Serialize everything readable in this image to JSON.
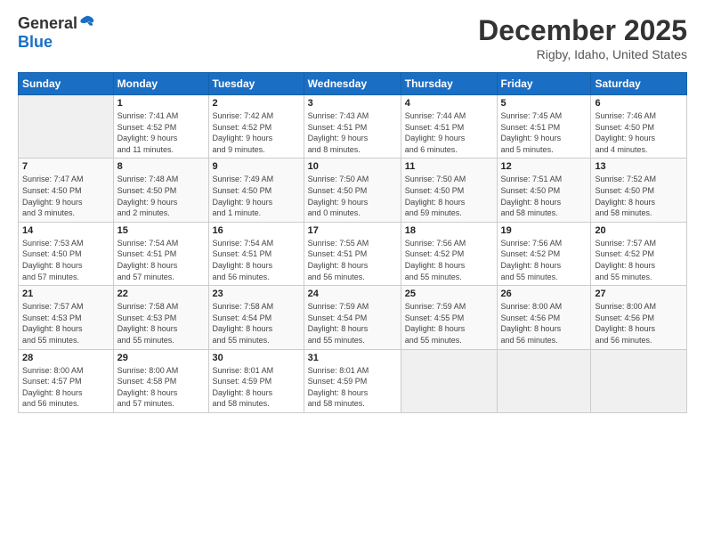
{
  "logo": {
    "general": "General",
    "blue": "Blue"
  },
  "title": "December 2025",
  "location": "Rigby, Idaho, United States",
  "days_header": [
    "Sunday",
    "Monday",
    "Tuesday",
    "Wednesday",
    "Thursday",
    "Friday",
    "Saturday"
  ],
  "weeks": [
    [
      {
        "num": "",
        "info": ""
      },
      {
        "num": "1",
        "info": "Sunrise: 7:41 AM\nSunset: 4:52 PM\nDaylight: 9 hours\nand 11 minutes."
      },
      {
        "num": "2",
        "info": "Sunrise: 7:42 AM\nSunset: 4:52 PM\nDaylight: 9 hours\nand 9 minutes."
      },
      {
        "num": "3",
        "info": "Sunrise: 7:43 AM\nSunset: 4:51 PM\nDaylight: 9 hours\nand 8 minutes."
      },
      {
        "num": "4",
        "info": "Sunrise: 7:44 AM\nSunset: 4:51 PM\nDaylight: 9 hours\nand 6 minutes."
      },
      {
        "num": "5",
        "info": "Sunrise: 7:45 AM\nSunset: 4:51 PM\nDaylight: 9 hours\nand 5 minutes."
      },
      {
        "num": "6",
        "info": "Sunrise: 7:46 AM\nSunset: 4:50 PM\nDaylight: 9 hours\nand 4 minutes."
      }
    ],
    [
      {
        "num": "7",
        "info": "Sunrise: 7:47 AM\nSunset: 4:50 PM\nDaylight: 9 hours\nand 3 minutes."
      },
      {
        "num": "8",
        "info": "Sunrise: 7:48 AM\nSunset: 4:50 PM\nDaylight: 9 hours\nand 2 minutes."
      },
      {
        "num": "9",
        "info": "Sunrise: 7:49 AM\nSunset: 4:50 PM\nDaylight: 9 hours\nand 1 minute."
      },
      {
        "num": "10",
        "info": "Sunrise: 7:50 AM\nSunset: 4:50 PM\nDaylight: 9 hours\nand 0 minutes."
      },
      {
        "num": "11",
        "info": "Sunrise: 7:50 AM\nSunset: 4:50 PM\nDaylight: 8 hours\nand 59 minutes."
      },
      {
        "num": "12",
        "info": "Sunrise: 7:51 AM\nSunset: 4:50 PM\nDaylight: 8 hours\nand 58 minutes."
      },
      {
        "num": "13",
        "info": "Sunrise: 7:52 AM\nSunset: 4:50 PM\nDaylight: 8 hours\nand 58 minutes."
      }
    ],
    [
      {
        "num": "14",
        "info": "Sunrise: 7:53 AM\nSunset: 4:50 PM\nDaylight: 8 hours\nand 57 minutes."
      },
      {
        "num": "15",
        "info": "Sunrise: 7:54 AM\nSunset: 4:51 PM\nDaylight: 8 hours\nand 57 minutes."
      },
      {
        "num": "16",
        "info": "Sunrise: 7:54 AM\nSunset: 4:51 PM\nDaylight: 8 hours\nand 56 minutes."
      },
      {
        "num": "17",
        "info": "Sunrise: 7:55 AM\nSunset: 4:51 PM\nDaylight: 8 hours\nand 56 minutes."
      },
      {
        "num": "18",
        "info": "Sunrise: 7:56 AM\nSunset: 4:52 PM\nDaylight: 8 hours\nand 55 minutes."
      },
      {
        "num": "19",
        "info": "Sunrise: 7:56 AM\nSunset: 4:52 PM\nDaylight: 8 hours\nand 55 minutes."
      },
      {
        "num": "20",
        "info": "Sunrise: 7:57 AM\nSunset: 4:52 PM\nDaylight: 8 hours\nand 55 minutes."
      }
    ],
    [
      {
        "num": "21",
        "info": "Sunrise: 7:57 AM\nSunset: 4:53 PM\nDaylight: 8 hours\nand 55 minutes."
      },
      {
        "num": "22",
        "info": "Sunrise: 7:58 AM\nSunset: 4:53 PM\nDaylight: 8 hours\nand 55 minutes."
      },
      {
        "num": "23",
        "info": "Sunrise: 7:58 AM\nSunset: 4:54 PM\nDaylight: 8 hours\nand 55 minutes."
      },
      {
        "num": "24",
        "info": "Sunrise: 7:59 AM\nSunset: 4:54 PM\nDaylight: 8 hours\nand 55 minutes."
      },
      {
        "num": "25",
        "info": "Sunrise: 7:59 AM\nSunset: 4:55 PM\nDaylight: 8 hours\nand 55 minutes."
      },
      {
        "num": "26",
        "info": "Sunrise: 8:00 AM\nSunset: 4:56 PM\nDaylight: 8 hours\nand 56 minutes."
      },
      {
        "num": "27",
        "info": "Sunrise: 8:00 AM\nSunset: 4:56 PM\nDaylight: 8 hours\nand 56 minutes."
      }
    ],
    [
      {
        "num": "28",
        "info": "Sunrise: 8:00 AM\nSunset: 4:57 PM\nDaylight: 8 hours\nand 56 minutes."
      },
      {
        "num": "29",
        "info": "Sunrise: 8:00 AM\nSunset: 4:58 PM\nDaylight: 8 hours\nand 57 minutes."
      },
      {
        "num": "30",
        "info": "Sunrise: 8:01 AM\nSunset: 4:59 PM\nDaylight: 8 hours\nand 58 minutes."
      },
      {
        "num": "31",
        "info": "Sunrise: 8:01 AM\nSunset: 4:59 PM\nDaylight: 8 hours\nand 58 minutes."
      },
      {
        "num": "",
        "info": ""
      },
      {
        "num": "",
        "info": ""
      },
      {
        "num": "",
        "info": ""
      }
    ]
  ]
}
